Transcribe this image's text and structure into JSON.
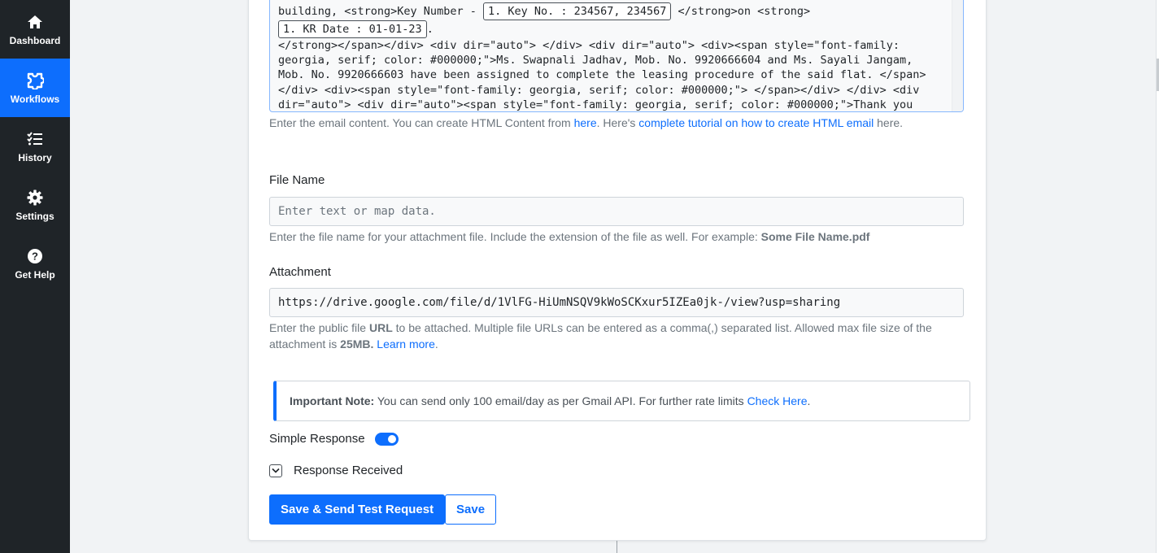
{
  "sidebar": {
    "items": [
      {
        "label": "Dashboard",
        "icon": "home-icon"
      },
      {
        "label": "Workflows",
        "icon": "workflow-icon"
      },
      {
        "label": "History",
        "icon": "list-icon"
      },
      {
        "label": "Settings",
        "icon": "gear-icon"
      },
      {
        "label": "Get Help",
        "icon": "help-icon"
      }
    ],
    "active": "Workflows"
  },
  "email_content": {
    "line1_before": "building, <strong>Key Number - ",
    "tag_key_number": "1. Key No. : 234567, 234567",
    "line1_middle": " </strong>on <strong>",
    "tag_kr_date": "1. KR Date : 01-01-23",
    "line1_after": ".",
    "body": "</strong></span></div> <div dir=\"auto\"> </div> <div dir=\"auto\"> <div><span style=\"font-family: georgia, serif; color: #000000;\">Ms. Swapnali Jadhav, Mob. No. 9920666604 and Ms. Sayali Jangam, Mob. No. 9920666603 have been assigned to complete the leasing procedure of the said flat. </span></div> <div><span style=\"font-family: georgia, serif; color: #000000;\"> </span></div> </div> <div dir=\"auto\"> <div dir=\"auto\"><span style=\"font-family: georgia, serif; color: #000000;\">Thank you for giving us an opportunity to serve you. </span></div> <div dir=\"auto\"> </div> <div dir=\"auto\"><span style=\"font-family: georgia, serif; color:",
    "help_prefix": "Enter the email content. You can create HTML Content from ",
    "help_link1": "here",
    "help_middle": ". Here's ",
    "help_link2": "complete tutorial on how to create HTML email",
    "help_suffix": " here."
  },
  "file_name": {
    "label": "File Name",
    "placeholder": "Enter text or map data.",
    "help_prefix": "Enter the file name for your attachment file. Include the extension of the file as well. For example: ",
    "help_example": "Some File Name.pdf"
  },
  "attachment": {
    "label": "Attachment",
    "value": "https://drive.google.com/file/d/1VlFG-HiUmNSQV9kWoSCKxur5IZEa0jk-/view?usp=sharing",
    "help_p1": "Enter the public file ",
    "help_url": "URL",
    "help_p2": " to be attached. Multiple file URLs can be entered as a comma(,) separated list. Allowed max file size of the attachment is ",
    "help_size": "25MB.",
    "help_link": "Learn more",
    "help_end": "."
  },
  "note": {
    "title": "Important Note:",
    "text": " You can send only 100 email/day as per Gmail API. For further rate limits ",
    "link": "Check Here",
    "end": "."
  },
  "simple_response": {
    "label": "Simple Response",
    "enabled": true
  },
  "response_received": {
    "label": "Response Received"
  },
  "buttons": {
    "save_send": "Save & Send Test Request",
    "save": "Save"
  },
  "colors": {
    "primary": "#0d6efd",
    "sidebar_bg": "#1f2428"
  }
}
